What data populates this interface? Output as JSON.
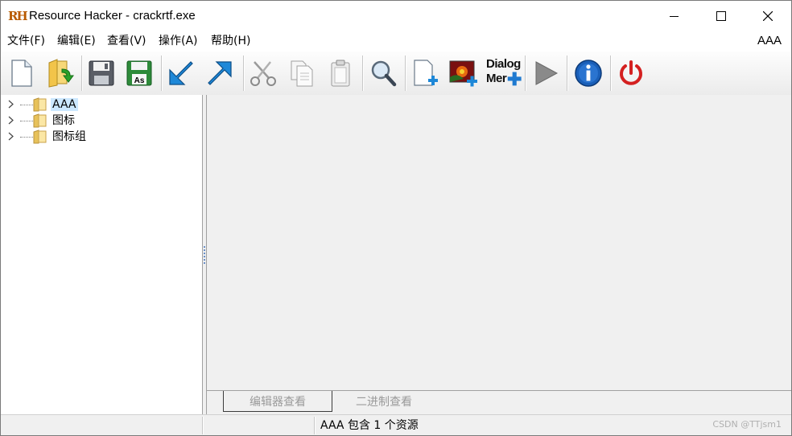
{
  "window": {
    "title": "Resource Hacker - crackrtf.exe",
    "logo_text": "RH"
  },
  "menu": {
    "items": [
      {
        "label": "文件(F)"
      },
      {
        "label": "编辑(E)"
      },
      {
        "label": "查看(V)"
      },
      {
        "label": "操作(A)"
      },
      {
        "label": "帮助(H)"
      }
    ],
    "right_label": "AAA"
  },
  "toolbar": {
    "buttons": [
      {
        "icon": "new-file-icon"
      },
      {
        "icon": "open-folder-icon"
      },
      {
        "icon": "save-icon"
      },
      {
        "icon": "save-as-icon",
        "badge": "As"
      },
      {
        "icon": "compile-arrow-icon"
      },
      {
        "icon": "export-arrow-icon"
      },
      {
        "icon": "cut-icon"
      },
      {
        "icon": "copy-icon"
      },
      {
        "icon": "paste-icon"
      },
      {
        "icon": "search-icon"
      },
      {
        "icon": "add-resource-icon"
      },
      {
        "icon": "add-image-resource-icon"
      },
      {
        "icon": "dialog-menu-editor-icon",
        "label_line1": "Dialog",
        "label_line2": "Mer"
      },
      {
        "icon": "play-icon"
      },
      {
        "icon": "info-icon"
      },
      {
        "icon": "power-icon"
      }
    ]
  },
  "tree": {
    "items": [
      {
        "label": "AAA",
        "selected": true
      },
      {
        "label": "图标",
        "selected": false
      },
      {
        "label": "图标组",
        "selected": false
      }
    ]
  },
  "tabs": [
    {
      "label": "编辑器查看",
      "active": true
    },
    {
      "label": "二进制查看",
      "active": false
    }
  ],
  "status": {
    "text": "AAA 包含 1 个资源",
    "watermark": "CSDN @TTjsm1"
  },
  "colors": {
    "accent_blue": "#1e88d8",
    "selection": "#cce8ff",
    "power_red": "#d42020"
  }
}
